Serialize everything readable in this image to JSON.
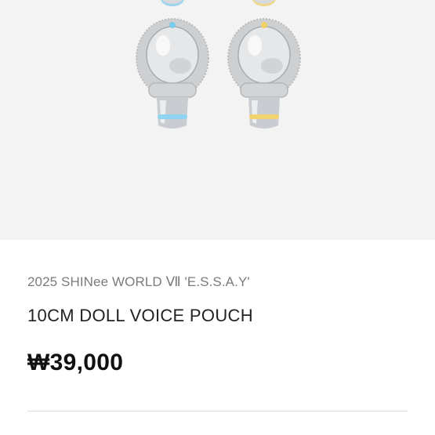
{
  "product": {
    "series": "2025 SHINee WORLD Ⅶ 'E.S.S.A.Y'",
    "name": "10CM DOLL VOICE POUCH",
    "price": "₩39,000"
  },
  "images": [
    {
      "icon": "voice-pouch-icon",
      "accent_color": "#8fd3f0"
    },
    {
      "icon": "voice-pouch-icon",
      "accent_color": "#f3d36e"
    }
  ],
  "colors": {
    "image_background": "#f3f3f3",
    "series_text": "#7b7b7b",
    "price_text": "#111111"
  }
}
